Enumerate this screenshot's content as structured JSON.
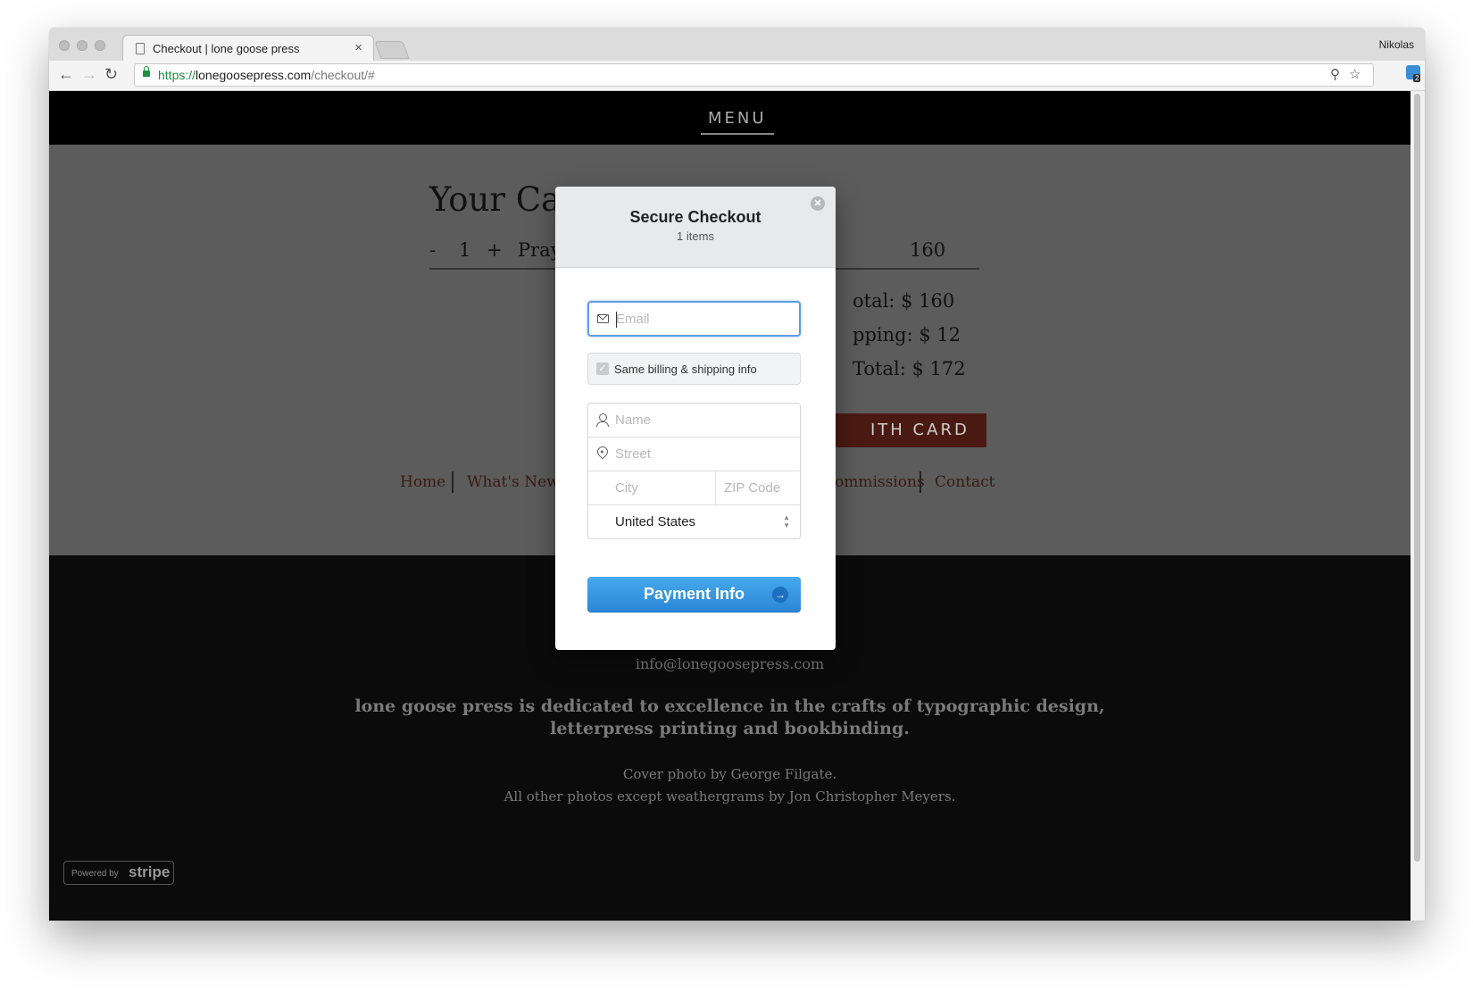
{
  "browser": {
    "tab_title": "Checkout | lone goose press",
    "tab_close": "×",
    "profile_name": "Nikolas",
    "url_scheme": "https://",
    "url_host": "lonegoosepress.com",
    "url_path": "/checkout/#",
    "ext_badge": "2"
  },
  "site": {
    "menu_label": "MENU",
    "cart_title": "Your Cart",
    "cart_row": {
      "minus": "-",
      "qty": "1",
      "plus": "+",
      "item": "Prayer",
      "price": "160"
    },
    "subtotal": "otal: $ 160",
    "shipping": "pping: $ 12",
    "total": "Total: $ 172",
    "card_button": "ITH CARD",
    "footer_links": [
      "Home",
      "What's New?",
      "ommissions",
      "Contact"
    ],
    "email": "info@lonegoosepress.com",
    "tagline_1": "lone goose press is dedicated to excellence in the crafts of typographic design,",
    "tagline_2": "letterpress printing and bookbinding.",
    "credit_1": "Cover photo by George Filgate.",
    "credit_2": "All other photos except weathergrams by Jon Christopher Meyers.",
    "stripe_powered": "Powered by",
    "stripe_brand": "stripe"
  },
  "modal": {
    "title": "Secure Checkout",
    "subtitle": "1 items",
    "close_glyph": "✕",
    "email_placeholder": "Email",
    "same_info_label": "Same billing & shipping info",
    "name_placeholder": "Name",
    "street_placeholder": "Street",
    "city_placeholder": "City",
    "zip_placeholder": "ZIP Code",
    "country_value": "United States",
    "pay_button": "Payment Info"
  },
  "colors": {
    "accent": "#2a86d6",
    "cart_bg": "#5c5c5c",
    "card_button": "#4a1a12"
  }
}
